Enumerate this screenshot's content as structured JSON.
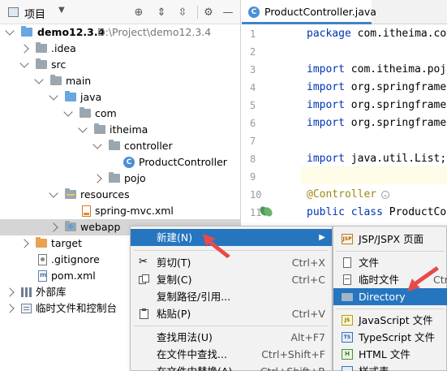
{
  "project_panel": {
    "title": "项目",
    "tree": [
      {
        "label": "demo12.3.4",
        "secondary": "D:\\Project\\demo12.3.4"
      },
      {
        "label": ".idea"
      },
      {
        "label": "src"
      },
      {
        "label": "main"
      },
      {
        "label": "java"
      },
      {
        "label": "com"
      },
      {
        "label": "itheima"
      },
      {
        "label": "controller"
      },
      {
        "label": "ProductController"
      },
      {
        "label": "pojo"
      },
      {
        "label": "resources"
      },
      {
        "label": "spring-mvc.xml"
      },
      {
        "label": "webapp"
      },
      {
        "label": "target"
      },
      {
        "label": ".gitignore"
      },
      {
        "label": "pom.xml"
      },
      {
        "label": "外部库"
      },
      {
        "label": "临时文件和控制台"
      }
    ]
  },
  "editor": {
    "tab_label": "ProductController.java",
    "lines": [
      {
        "num": "1",
        "kw": "package",
        "rest": " com.itheima.co"
      },
      {
        "num": "2",
        "kw": "",
        "rest": ""
      },
      {
        "num": "3",
        "kw": "import",
        "rest": " com.itheima.poj"
      },
      {
        "num": "4",
        "kw": "import",
        "rest": " org.springframe"
      },
      {
        "num": "5",
        "kw": "import",
        "rest": " org.springframe"
      },
      {
        "num": "6",
        "kw": "import",
        "rest": " org.springframe"
      },
      {
        "num": "7",
        "kw": "",
        "rest": ""
      },
      {
        "num": "8",
        "kw": "import",
        "rest": " java.util.List;"
      },
      {
        "num": "9",
        "kw": "",
        "rest": ""
      },
      {
        "num": "10",
        "kw": "",
        "rest": "@Controller"
      },
      {
        "num": "11",
        "kw": "public class",
        "rest": " ProductCo"
      }
    ]
  },
  "context_menu": {
    "items": [
      {
        "label": "新建(N)",
        "shortcut": ""
      },
      {
        "label": "剪切(T)",
        "shortcut": "Ctrl+X"
      },
      {
        "label": "复制(C)",
        "shortcut": "Ctrl+C"
      },
      {
        "label": "复制路径/引用...",
        "shortcut": ""
      },
      {
        "label": "粘贴(P)",
        "shortcut": "Ctrl+V"
      },
      {
        "label": "查找用法(U)",
        "shortcut": "Alt+F7"
      },
      {
        "label": "在文件中查找...",
        "shortcut": "Ctrl+Shift+F"
      },
      {
        "label": "在文件中替换(A)...",
        "shortcut": "Ctrl+Shift+R"
      }
    ]
  },
  "submenu": {
    "items": [
      {
        "label": "JSP/JSPX 页面",
        "shortcut": ""
      },
      {
        "label": "文件",
        "shortcut": ""
      },
      {
        "label": "临时文件",
        "shortcut": "Ctrl"
      },
      {
        "label": "Directory",
        "shortcut": ""
      },
      {
        "label": "JavaScript 文件",
        "shortcut": ""
      },
      {
        "label": "TypeScript 文件",
        "shortcut": ""
      },
      {
        "label": "HTML 文件",
        "shortcut": ""
      },
      {
        "label": "样式表",
        "shortcut": ""
      }
    ]
  },
  "colors": {
    "selection": "#2675bf",
    "keyword": "#0033b3",
    "annotation": "#9e880d",
    "arrow": "#e84a4a"
  }
}
